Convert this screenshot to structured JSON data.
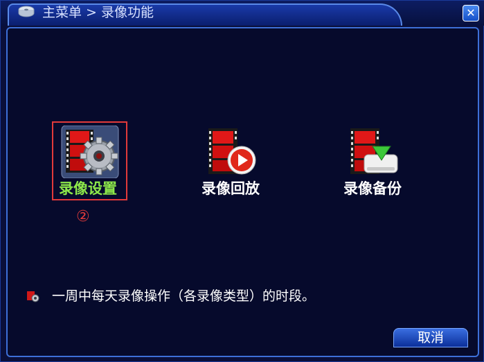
{
  "window": {
    "breadcrumb": "主菜单 > 录像功能",
    "close_label": "✕"
  },
  "menu": {
    "items": [
      {
        "label": "录像设置",
        "selected": true,
        "label_color": "#8ee84a"
      },
      {
        "label": "录像回放",
        "selected": false,
        "label_color": "#ffffff"
      },
      {
        "label": "录像备份",
        "selected": false,
        "label_color": "#ffffff"
      }
    ],
    "selection_marker": "②"
  },
  "hint": {
    "text": "一周中每天录像操作（各录像类型）的时段。"
  },
  "footer": {
    "cancel_label": "取消"
  },
  "colors": {
    "accent_border": "#3d6fd8",
    "selection_frame": "#e23a3a",
    "selected_label": "#8ee84a",
    "background": "#060a2c"
  }
}
